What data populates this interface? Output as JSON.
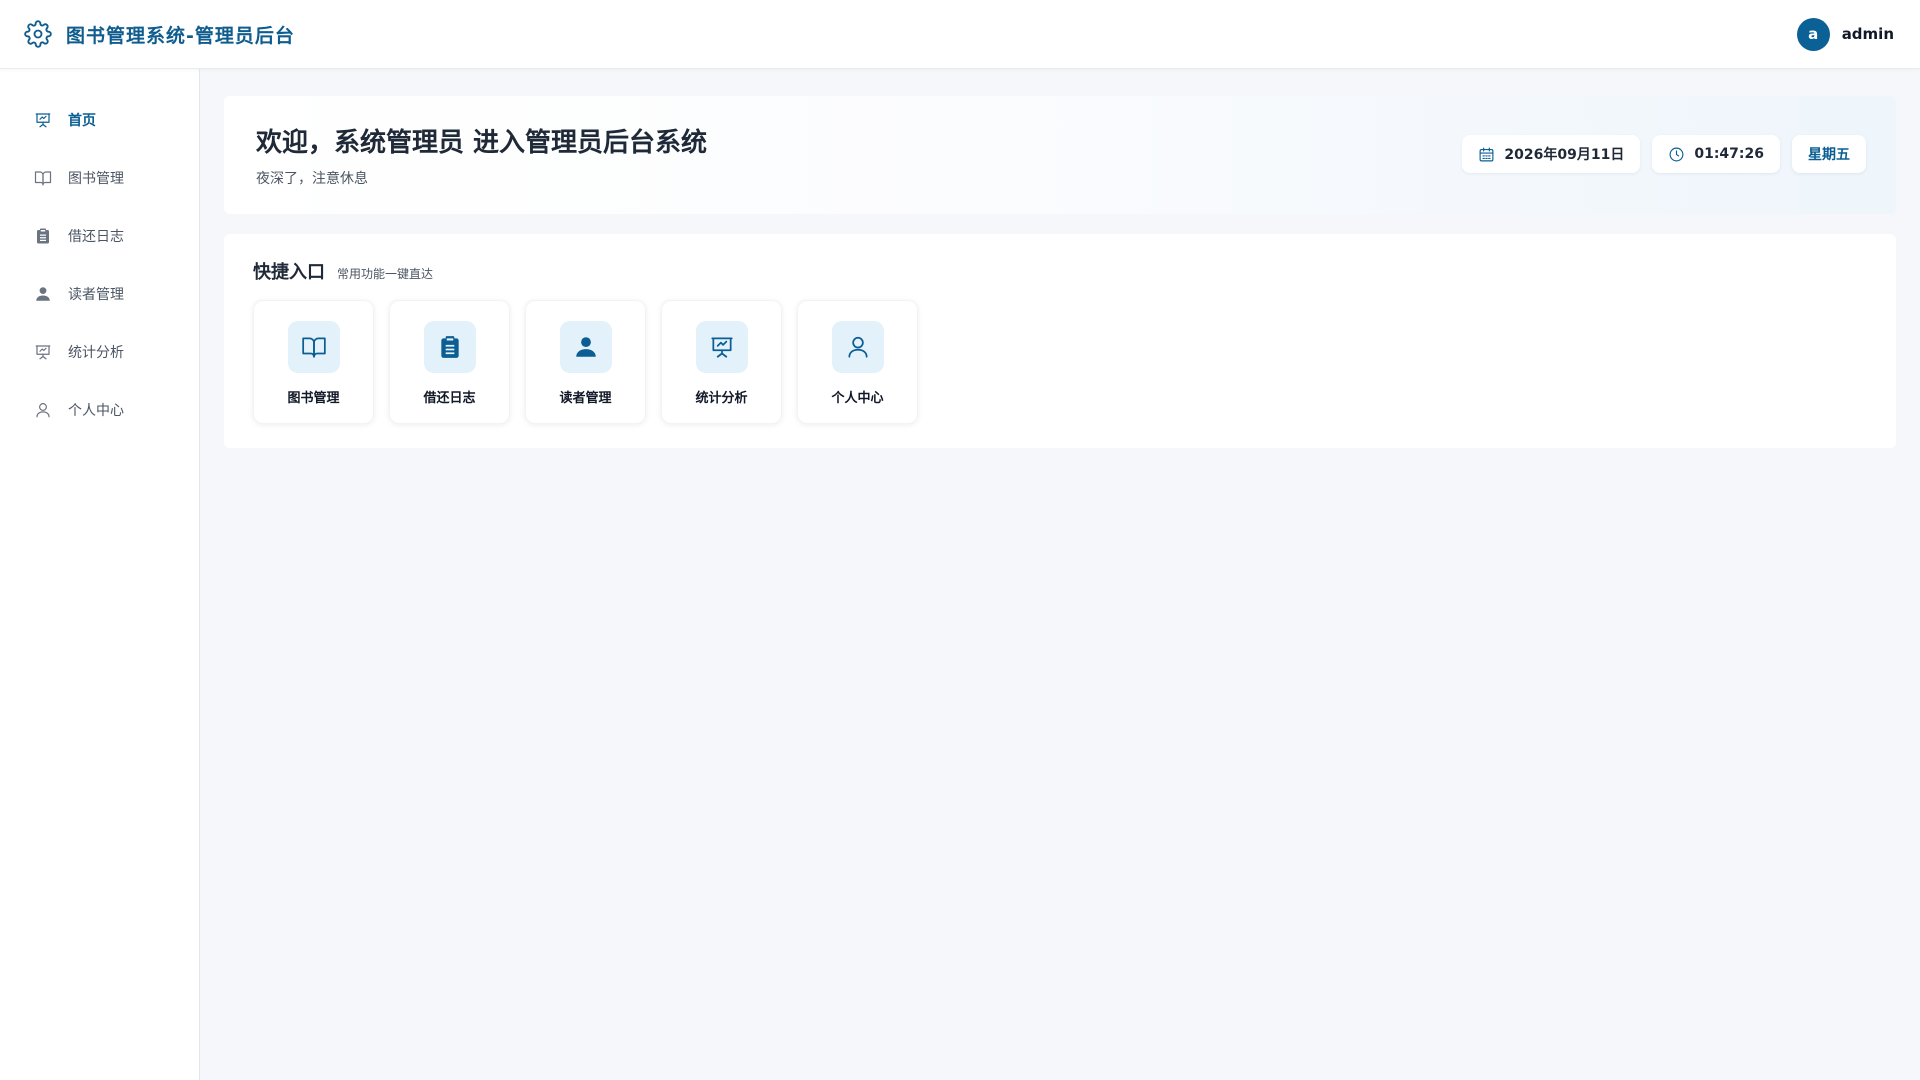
{
  "header": {
    "title": "图书管理系统-管理员后台",
    "icon": "gear-icon",
    "user": {
      "avatar_letter": "a",
      "name": "admin"
    }
  },
  "sidebar": {
    "items": [
      {
        "label": "首页",
        "icon": "presentation-chart-icon",
        "active": true
      },
      {
        "label": "图书管理",
        "icon": "book-open-icon",
        "active": false
      },
      {
        "label": "借还日志",
        "icon": "clipboard-icon",
        "active": false
      },
      {
        "label": "读者管理",
        "icon": "user-filled-icon",
        "active": false
      },
      {
        "label": "统计分析",
        "icon": "presentation-chart-icon",
        "active": false
      },
      {
        "label": "个人中心",
        "icon": "user-outline-icon",
        "active": false
      }
    ]
  },
  "welcome": {
    "title": "欢迎，系统管理员 进入管理员后台系统",
    "subtitle": "夜深了，注意休息",
    "date": "2026年09月11日",
    "time": "01:47:26",
    "weekday": "星期五"
  },
  "quick": {
    "title": "快捷入口",
    "subtitle": "常用功能一键直达",
    "cards": [
      {
        "label": "图书管理",
        "icon": "book-open-icon"
      },
      {
        "label": "借还日志",
        "icon": "clipboard-icon"
      },
      {
        "label": "读者管理",
        "icon": "user-filled-icon"
      },
      {
        "label": "统计分析",
        "icon": "presentation-chart-icon"
      },
      {
        "label": "个人中心",
        "icon": "user-outline-icon"
      }
    ]
  },
  "colors": {
    "accent": "#0b5e93",
    "background": "#f5f7fa",
    "card_icon_bg": "#e3f1fb"
  }
}
